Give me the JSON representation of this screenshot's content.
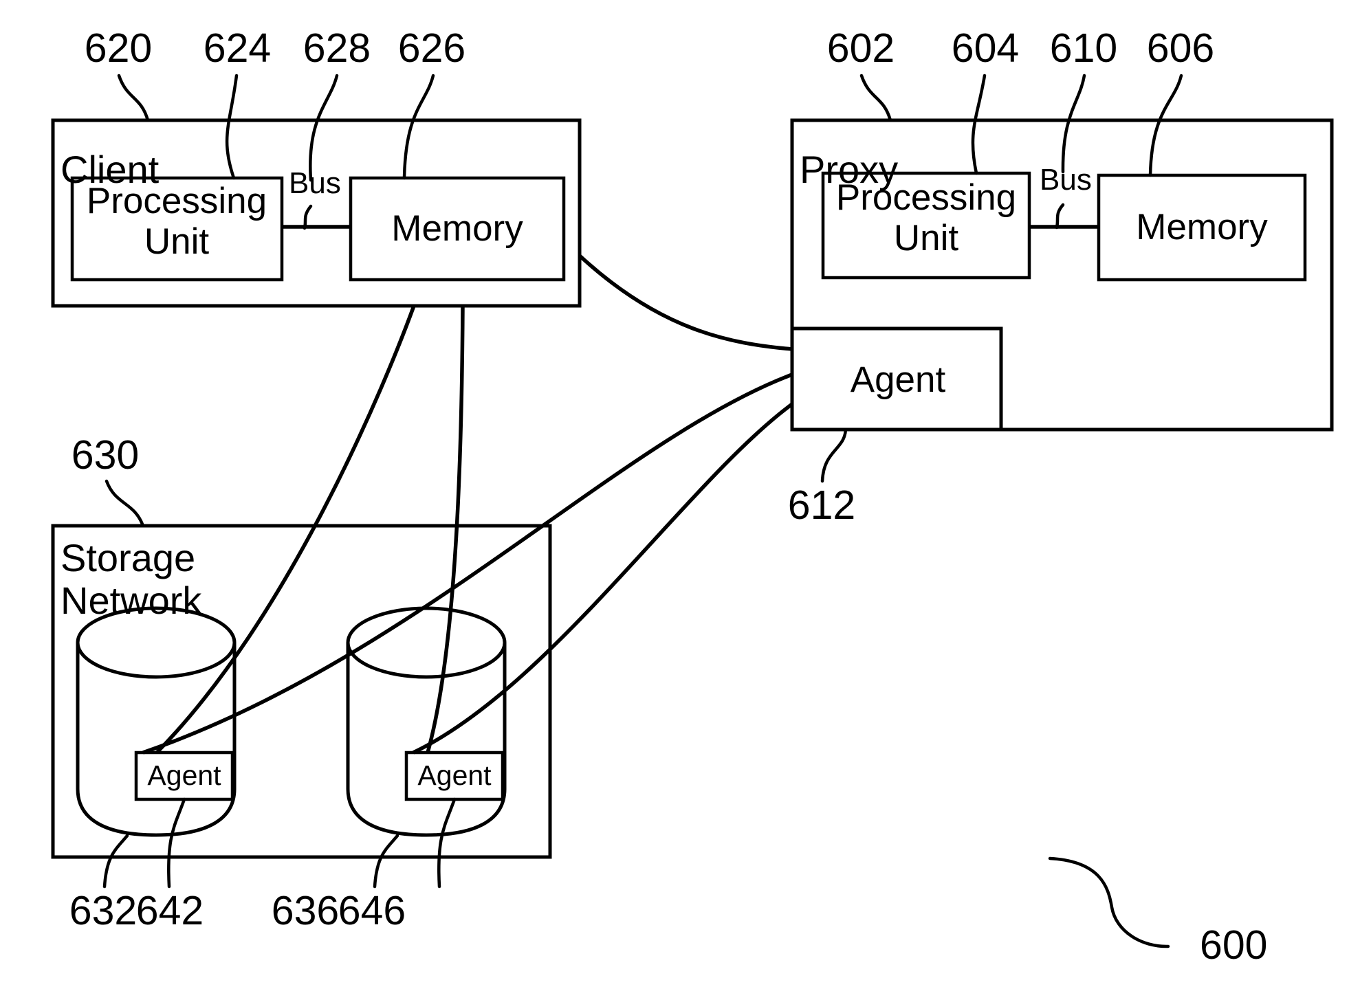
{
  "figure": {
    "number": "600",
    "type": "patent-block-diagram"
  },
  "client": {
    "title": "Client",
    "ref": "620",
    "processing_unit": {
      "line1": "Processing",
      "line2": "Unit",
      "ref": "624"
    },
    "bus": {
      "label": "Bus",
      "ref": "628"
    },
    "memory": {
      "label": "Memory",
      "ref": "626"
    }
  },
  "proxy": {
    "title": "Proxy",
    "ref": "602",
    "processing_unit": {
      "line1": "Processing",
      "line2": "Unit",
      "ref": "604"
    },
    "bus": {
      "label": "Bus",
      "ref": "610"
    },
    "memory": {
      "label": "Memory",
      "ref": "606"
    },
    "agent": {
      "label": "Agent",
      "ref": "612"
    }
  },
  "storage_network": {
    "title_line1": "Storage",
    "title_line2": "Network",
    "ref": "630",
    "devices": [
      {
        "ref": "632",
        "agent": {
          "label": "Agent",
          "ref": "642"
        }
      },
      {
        "ref": "636",
        "agent": {
          "label": "Agent",
          "ref": "646"
        }
      }
    ]
  },
  "colors": {
    "stroke": "#000000",
    "background": "#ffffff"
  }
}
